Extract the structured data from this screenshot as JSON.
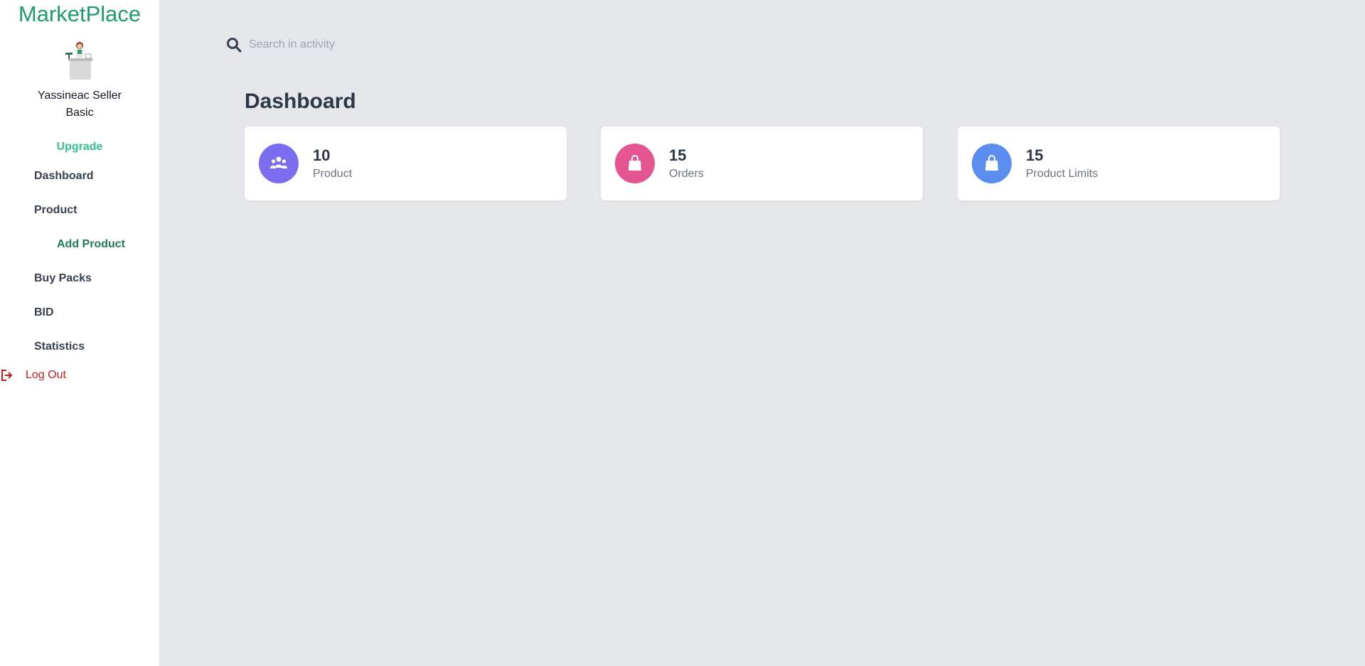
{
  "app": {
    "brand": "MarketPlace"
  },
  "user": {
    "name": "Yassineac Seller",
    "plan": "Basic",
    "upgrade_label": "Upgrade",
    "avatar_icon": "seller-avatar-icon"
  },
  "sidebar": {
    "items": [
      {
        "label": "Dashboard"
      },
      {
        "label": "Product"
      },
      {
        "label": "Add Product"
      },
      {
        "label": "Buy Packs"
      },
      {
        "label": "BID"
      },
      {
        "label": "Statistics"
      }
    ],
    "logout_label": "Log Out",
    "logout_icon": "logout-icon"
  },
  "search": {
    "placeholder": "Search in activity",
    "icon": "search-icon"
  },
  "page": {
    "title": "Dashboard"
  },
  "stats": [
    {
      "value": "10",
      "label": "Product",
      "icon": "users-icon",
      "color": "#7c6cf0"
    },
    {
      "value": "15",
      "label": "Orders",
      "icon": "shopping-bag-icon",
      "color": "#e55592"
    },
    {
      "value": "15",
      "label": "Product Limits",
      "icon": "shopping-bag-icon",
      "color": "#5b8def"
    }
  ],
  "colors": {
    "brand": "#1f9d6a",
    "upgrade": "#34c38f",
    "logout": "#c81e1e",
    "background": "#e5e7eb"
  }
}
